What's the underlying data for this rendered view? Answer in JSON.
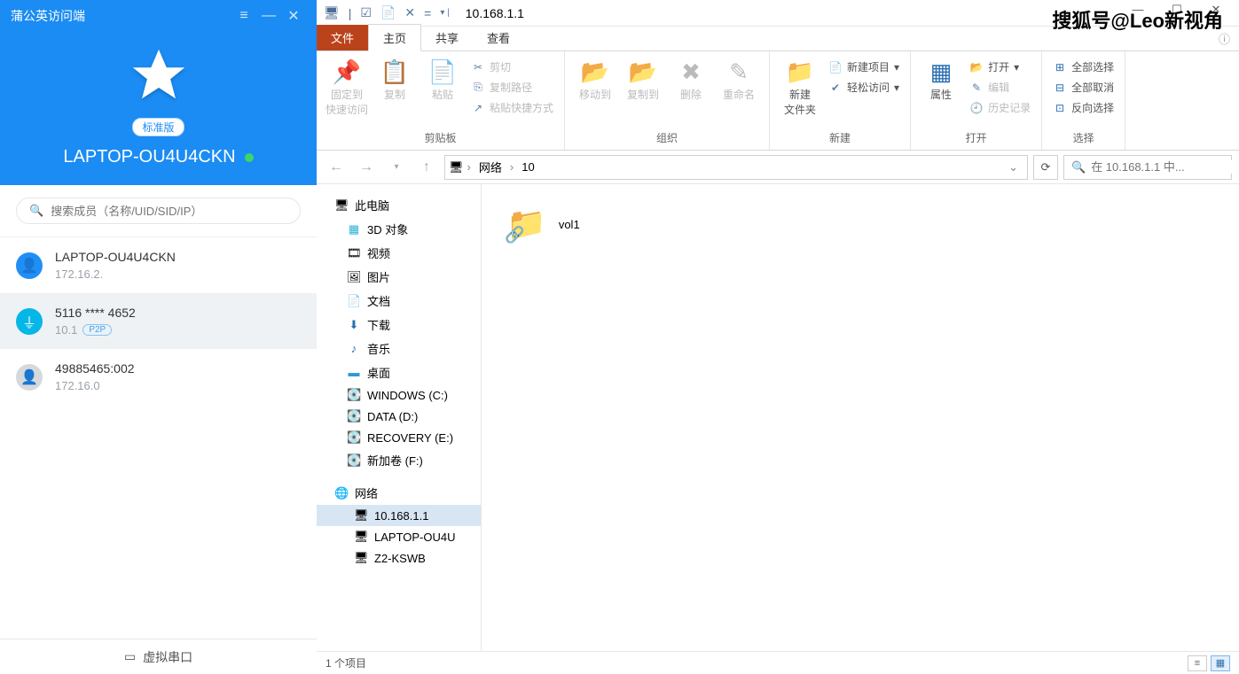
{
  "watermark": "搜狐号@Leo新视角",
  "vpn": {
    "title": "蒲公英访问端",
    "badge": "标准版",
    "device": "LAPTOP-OU4U4CKN",
    "search_placeholder": "搜索成员（名称/UID/SID/IP）",
    "members": [
      {
        "name": "LAPTOP-OU4U4CKN",
        "ip": "172.16.2.",
        "avatar": "blue",
        "p2p": false
      },
      {
        "name": "5116 **** 4652",
        "ip": "10.1",
        "avatar": "cyan",
        "p2p": true,
        "selected": true
      },
      {
        "name": "49885465:002",
        "ip": "172.16.0",
        "avatar": "gray",
        "p2p": false
      }
    ],
    "footer": "虚拟串口"
  },
  "explorer": {
    "title": "10.168.1.1",
    "tabs": {
      "file": "文件",
      "home": "主页",
      "share": "共享",
      "view": "查看"
    },
    "ribbon": {
      "pin": "固定到\n快速访问",
      "copy": "复制",
      "paste": "粘贴",
      "cut": "剪切",
      "copypath": "复制路径",
      "pasteshort": "粘贴快捷方式",
      "moveto": "移动到",
      "copyto": "复制到",
      "delete": "删除",
      "rename": "重命名",
      "newfolder": "新建\n文件夹",
      "newitem": "新建项目",
      "easyaccess": "轻松访问",
      "props": "属性",
      "open": "打开",
      "edit": "编辑",
      "history": "历史记录",
      "selall": "全部选择",
      "selnone": "全部取消",
      "selinv": "反向选择",
      "g_clip": "剪贴板",
      "g_org": "组织",
      "g_new": "新建",
      "g_open": "打开",
      "g_sel": "选择"
    },
    "breadcrumb": {
      "root": "网络",
      "node": "10",
      "search_placeholder": "在 10.168.1.1 中..."
    },
    "tree": {
      "thispc": "此电脑",
      "obj3d": "3D 对象",
      "video": "视频",
      "pics": "图片",
      "docs": "文档",
      "downloads": "下载",
      "music": "音乐",
      "desktop": "桌面",
      "drivec": "WINDOWS (C:)",
      "drived": "DATA (D:)",
      "drivee": "RECOVERY (E:)",
      "drivef": "新加卷 (F:)",
      "network": "网络",
      "net1": "10.168.1.1",
      "net2": "LAPTOP-OU4U",
      "net3": "Z2-KSWB"
    },
    "content": {
      "item1": "vol1"
    },
    "status": "1 个项目"
  }
}
